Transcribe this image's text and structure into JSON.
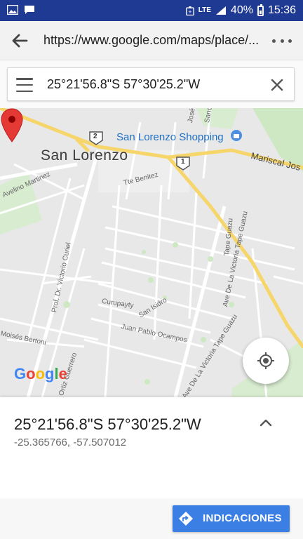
{
  "statusbar": {
    "lte": "LTE",
    "battery": "40%",
    "time": "15:36"
  },
  "browser": {
    "url": "https://www.google.com/maps/place/...",
    "back_icon": "arrow-left-icon",
    "menu_icon": "more-horizontal-icon"
  },
  "search": {
    "value": "25°21'56.8\"S 57°30'25.2\"W",
    "menu_icon": "hamburger-icon",
    "clear_icon": "close-icon"
  },
  "map": {
    "city_label": "San Lorenzo",
    "poi_label": "San Lorenzo Shopping",
    "road_label_mariscal": "Mariscal Jos",
    "road_label_avelino": "Avelino Martinez",
    "road_label_tte": "Tte Benitez",
    "road_label_victoria_curiel": "Prof. Dr. Victorio Curiel",
    "road_label_curupayty": "Curupayty",
    "road_label_san_isidro": "San Isidro",
    "road_label_juan_pablo": "Juan Pablo Ocampos",
    "road_label_moises": "Moisés Bertoni",
    "road_label_ortiz": "Ortiz Guerrero",
    "road_label_tape_guazu": "Ave De La Victoria Tape Guazu",
    "road_label_tape_guazu2": "Ave De La Victoria Tape Guazu",
    "road_label_tape_guazu_top": "Tape Guazu",
    "road_label_jose": "José",
    "road_label_sanc": "Sanc",
    "shield_2": "2",
    "shield_1": "1",
    "logo": [
      "G",
      "o",
      "o",
      "g",
      "l",
      "e"
    ],
    "logo_colors": [
      "#4285F4",
      "#EA4335",
      "#FBBC05",
      "#4285F4",
      "#34A853",
      "#EA4335"
    ],
    "pin_color": "#E53935",
    "road_color_major": "#F6D66B",
    "locate_icon": "my-location-icon"
  },
  "place": {
    "coords": "25°21'56.8\"S 57°30'25.2\"W",
    "decimal": "-25.365766, -57.507012",
    "expand_icon": "chevron-up-icon"
  },
  "footer": {
    "directions_label": "INDICACIONES",
    "directions_icon": "directions-icon",
    "button_color": "#3B7EE4"
  }
}
